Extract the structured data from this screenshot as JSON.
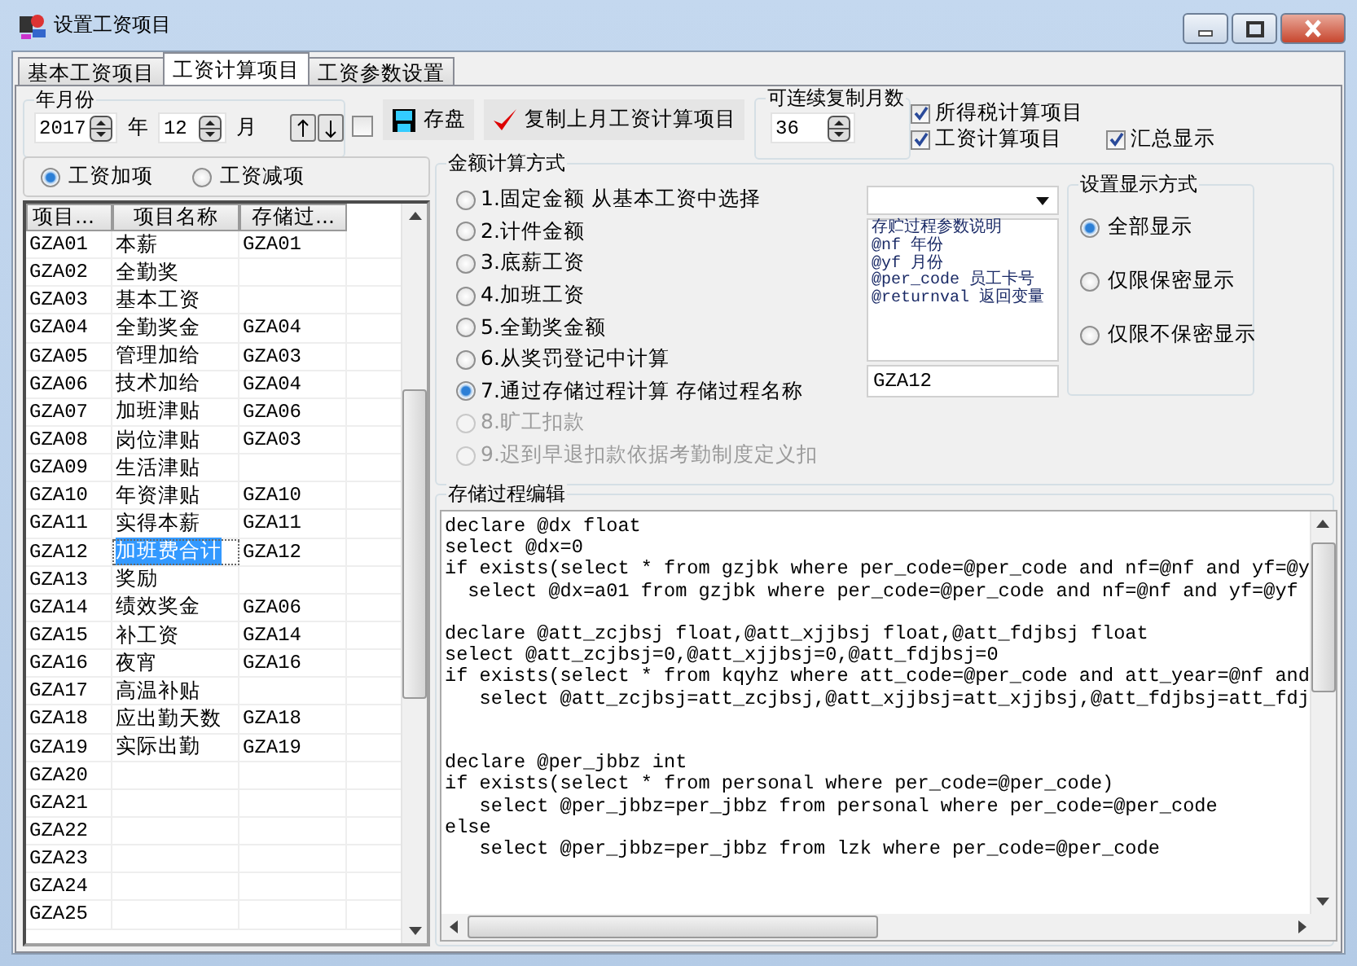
{
  "window": {
    "title": "设置工资项目"
  },
  "tabs": [
    {
      "label": "基本工资项目",
      "selected": false
    },
    {
      "label": "工资计算项目",
      "selected": true
    },
    {
      "label": "工资参数设置",
      "selected": false
    }
  ],
  "period": {
    "legend": "年月份",
    "year": "2017",
    "year_unit": "年",
    "month": "12",
    "month_unit": "月"
  },
  "flag_checkbox": {
    "checked": false
  },
  "buttons": [
    {
      "kind": "save",
      "label": "存盘"
    },
    {
      "kind": "copy",
      "label": "复制上月工资计算项目"
    }
  ],
  "copy_months": {
    "legend": "可连续复制月数",
    "value": "36"
  },
  "options": [
    {
      "label": "所得税计算项目",
      "checked": true
    },
    {
      "label": "工资计算项目",
      "checked": true
    },
    {
      "label": "汇总显示",
      "checked": true
    }
  ],
  "item_type": [
    {
      "label": "工资加项",
      "selected": true
    },
    {
      "label": "工资减项",
      "selected": false
    }
  ],
  "table": {
    "columns": [
      "项目...",
      "项目名称",
      "存储过..."
    ],
    "rows": [
      {
        "cells": [
          "GZA01",
          "本薪",
          "GZA01"
        ],
        "selected": false
      },
      {
        "cells": [
          "GZA02",
          "全勤奖",
          ""
        ],
        "selected": false
      },
      {
        "cells": [
          "GZA03",
          "基本工资",
          ""
        ],
        "selected": false
      },
      {
        "cells": [
          "GZA04",
          "全勤奖金",
          "GZA04"
        ],
        "selected": false
      },
      {
        "cells": [
          "GZA05",
          "管理加给",
          "GZA03"
        ],
        "selected": false
      },
      {
        "cells": [
          "GZA06",
          "技术加给",
          "GZA04"
        ],
        "selected": false
      },
      {
        "cells": [
          "GZA07",
          "加班津贴",
          "GZA06"
        ],
        "selected": false
      },
      {
        "cells": [
          "GZA08",
          "岗位津贴",
          "GZA03"
        ],
        "selected": false
      },
      {
        "cells": [
          "GZA09",
          "生活津贴",
          ""
        ],
        "selected": false
      },
      {
        "cells": [
          "GZA10",
          "年资津贴",
          "GZA10"
        ],
        "selected": false
      },
      {
        "cells": [
          "GZA11",
          "实得本薪",
          "GZA11"
        ],
        "selected": false
      },
      {
        "cells": [
          "GZA12",
          "加班费合计",
          "GZA12"
        ],
        "selected": true
      },
      {
        "cells": [
          "GZA13",
          "奖励",
          ""
        ],
        "selected": false
      },
      {
        "cells": [
          "GZA14",
          "绩效奖金",
          "GZA06"
        ],
        "selected": false
      },
      {
        "cells": [
          "GZA15",
          "补工资",
          "GZA14"
        ],
        "selected": false
      },
      {
        "cells": [
          "GZA16",
          "夜宵",
          "GZA16"
        ],
        "selected": false
      },
      {
        "cells": [
          "GZA17",
          "高温补贴",
          ""
        ],
        "selected": false
      },
      {
        "cells": [
          "GZA18",
          "应出勤天数",
          "GZA18"
        ],
        "selected": false
      },
      {
        "cells": [
          "GZA19",
          "实际出勤",
          "GZA19"
        ],
        "selected": false
      },
      {
        "cells": [
          "GZA20",
          "",
          ""
        ],
        "selected": false
      },
      {
        "cells": [
          "GZA21",
          "",
          ""
        ],
        "selected": false
      },
      {
        "cells": [
          "GZA22",
          "",
          ""
        ],
        "selected": false
      },
      {
        "cells": [
          "GZA23",
          "",
          ""
        ],
        "selected": false
      },
      {
        "cells": [
          "GZA24",
          "",
          ""
        ],
        "selected": false
      },
      {
        "cells": [
          "GZA25",
          "",
          ""
        ],
        "selected": false
      }
    ]
  },
  "calc_method": {
    "legend": "金额计算方式",
    "options": [
      {
        "label": "1.固定金额 从基本工资中选择",
        "selected": false,
        "disabled": false
      },
      {
        "label": "2.计件金额",
        "selected": false,
        "disabled": false
      },
      {
        "label": "3.底薪工资",
        "selected": false,
        "disabled": false
      },
      {
        "label": "4.加班工资",
        "selected": false,
        "disabled": false
      },
      {
        "label": "5.全勤奖金额",
        "selected": false,
        "disabled": false
      },
      {
        "label": "6.从奖罚登记中计算",
        "selected": false,
        "disabled": false
      },
      {
        "label": "7.通过存储过程计算 存储过程名称",
        "selected": true,
        "disabled": false
      },
      {
        "label": "8.旷工扣款",
        "selected": false,
        "disabled": true
      },
      {
        "label": "9.迟到早退扣款依据考勤制度定义扣",
        "selected": false,
        "disabled": true
      }
    ],
    "param_notes": "存贮过程参数说明\n@nf 年份\n@yf 月份\n@per_code 员工卡号\n@returnval 返回变量",
    "procedure_name": "GZA12"
  },
  "display_mode": {
    "legend": "设置显示方式",
    "options": [
      {
        "label": "全部显示",
        "selected": true
      },
      {
        "label": "仅限保密显示",
        "selected": false
      },
      {
        "label": "仅限不保密显示",
        "selected": false
      }
    ]
  },
  "editor": {
    "legend": "存储过程编辑",
    "code": "declare @dx float\nselect @dx=0\nif exists(select * from gzjbk where per_code=@per_code and nf=@nf and yf=@y\n  select @dx=a01 from gzjbk where per_code=@per_code and nf=@nf and yf=@yf\n\ndeclare @att_zcjbsj float,@att_xjjbsj float,@att_fdjbsj float\nselect @att_zcjbsj=0,@att_xjjbsj=0,@att_fdjbsj=0\nif exists(select * from kqyhz where att_code=@per_code and att_year=@nf and\n   select @att_zcjbsj=att_zcjbsj,@att_xjjbsj=att_xjjbsj,@att_fdjbsj=att_fdj\n\n\ndeclare @per_jbbz int\nif exists(select * from personal where per_code=@per_code)\n   select @per_jbbz=per_jbbz from personal where per_code=@per_code\nelse\n   select @per_jbbz=per_jbbz from lzk where per_code=@per_code"
  }
}
